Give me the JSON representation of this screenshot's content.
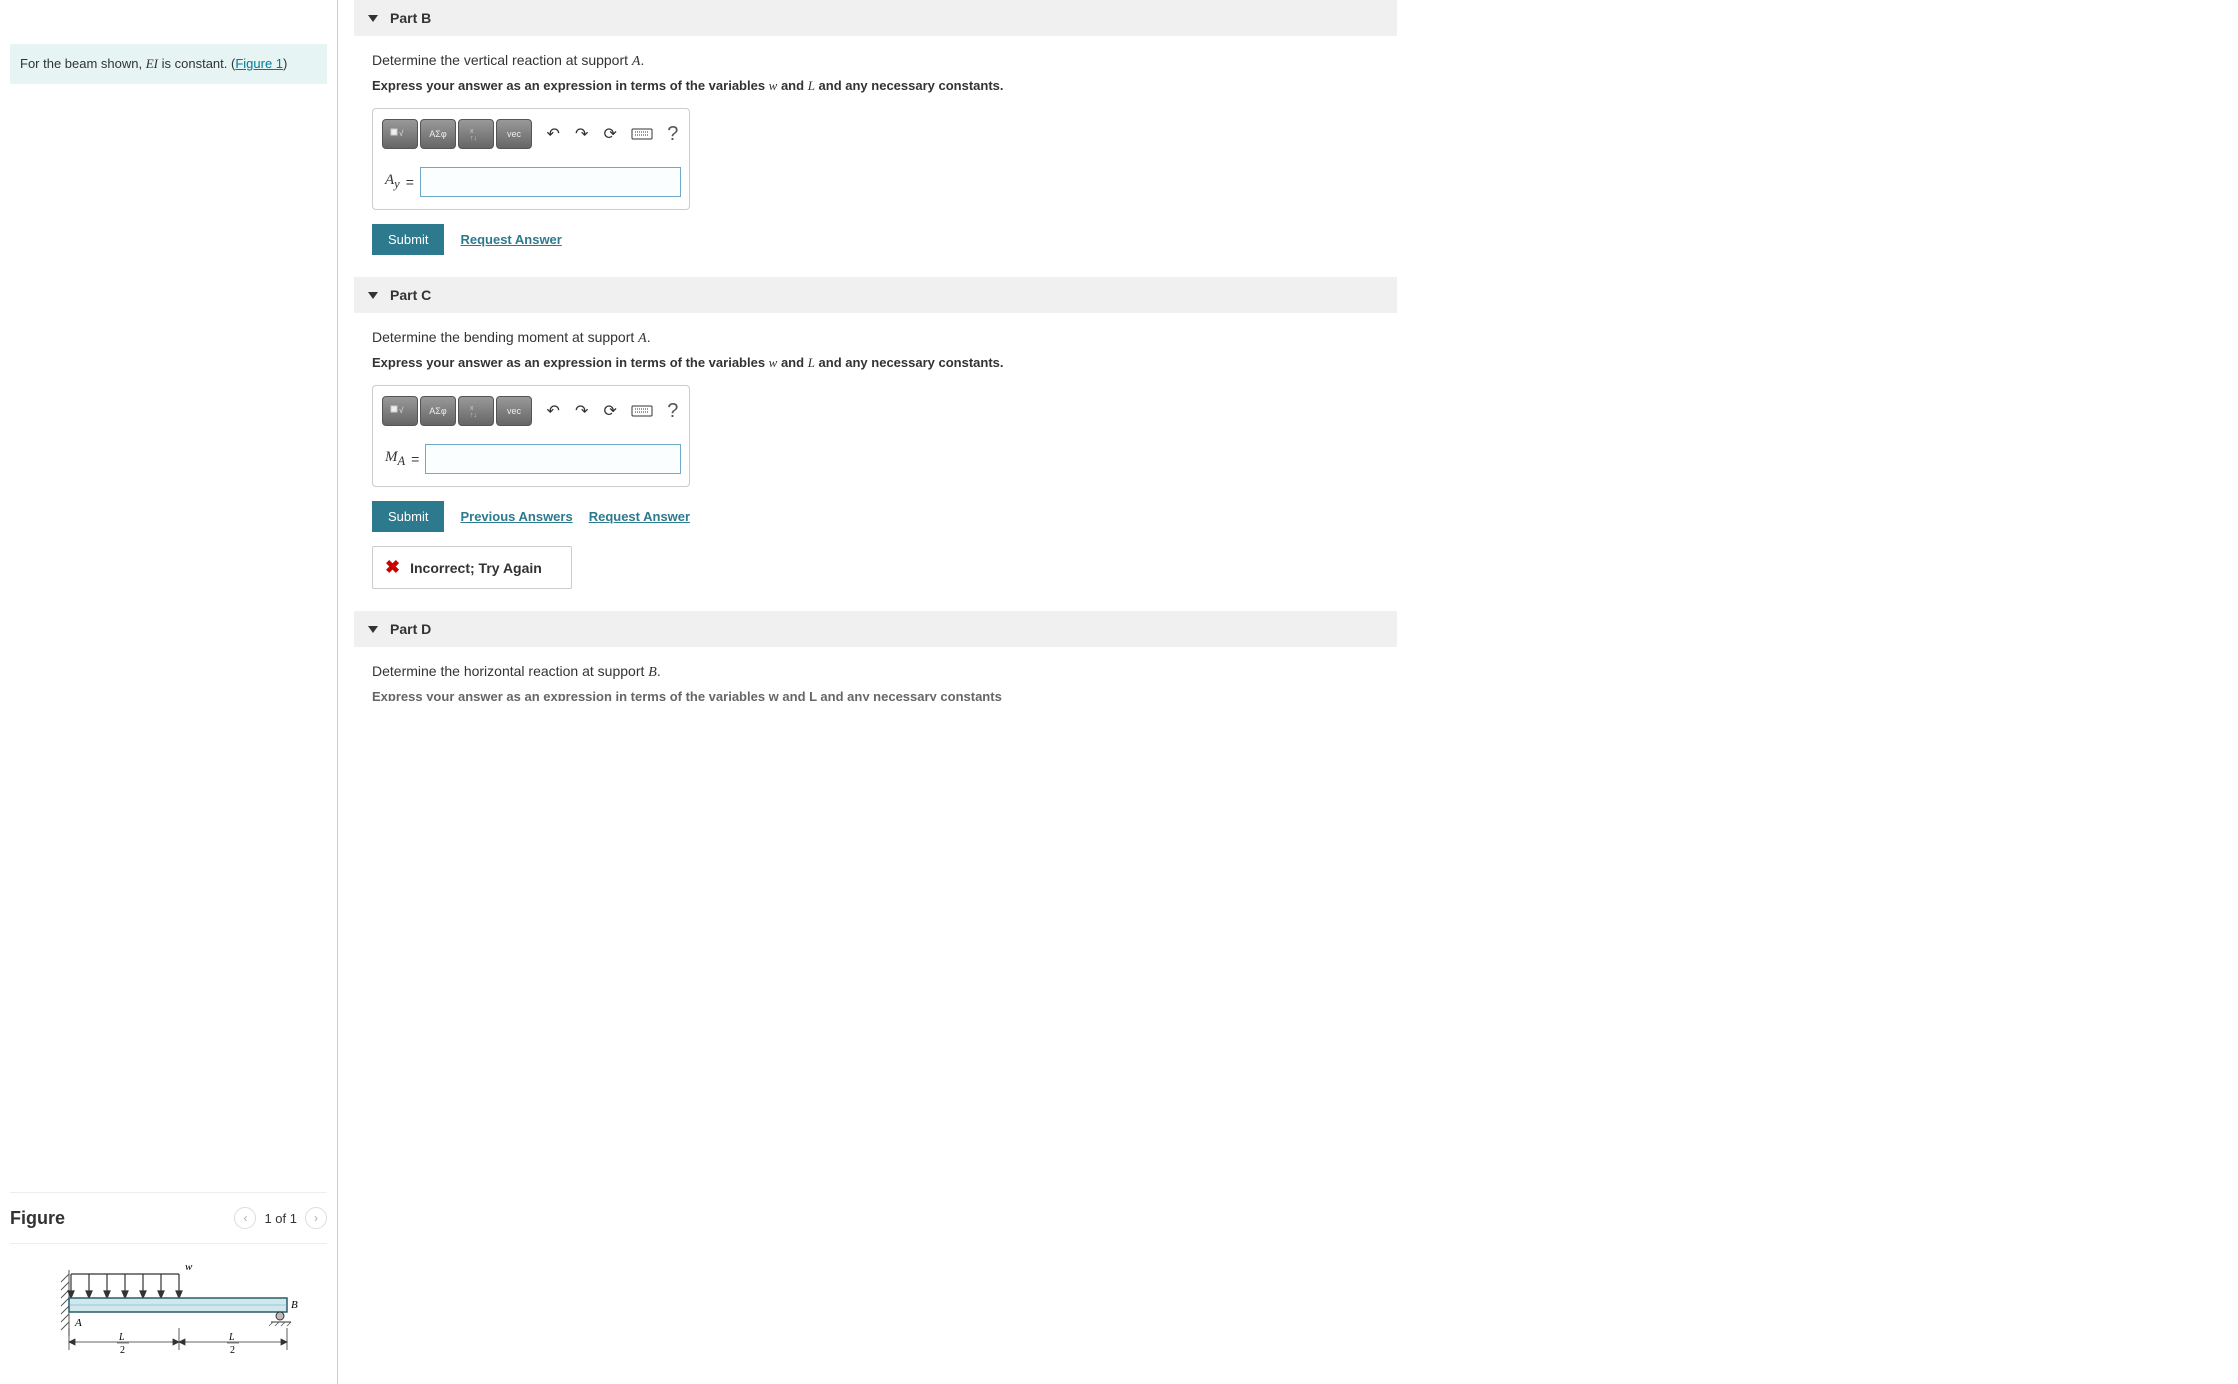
{
  "problem": {
    "text_before": "For the beam shown, ",
    "ei": "EI",
    "text_mid": " is constant. (",
    "figure_link": "Figure 1",
    "text_after": ")"
  },
  "figure": {
    "title": "Figure",
    "count": "1 of 1",
    "label_w": "w",
    "label_A": "A",
    "label_B": "B",
    "dim_left": "L",
    "dim_left_denom": "2",
    "dim_right": "L",
    "dim_right_denom": "2"
  },
  "parts": {
    "B": {
      "title": "Part B",
      "question_pre": "Determine the vertical reaction at support ",
      "question_var": "A",
      "question_post": ".",
      "instruction_pre": "Express your answer as an expression in terms of the variables ",
      "instruction_w": "w",
      "instruction_and": " and ",
      "instruction_L": "L",
      "instruction_post": " and any necessary constants.",
      "var_label": "A",
      "var_sub": "y",
      "answer_value": "",
      "submit": "Submit",
      "request": "Request Answer"
    },
    "C": {
      "title": "Part C",
      "question_pre": "Determine the bending moment at support ",
      "question_var": "A",
      "question_post": ".",
      "instruction_pre": "Express your answer as an expression in terms of the variables ",
      "instruction_w": "w",
      "instruction_and": " and ",
      "instruction_L": "L",
      "instruction_post": " and any necessary constants.",
      "var_label": "M",
      "var_sub": "A",
      "answer_value": "",
      "submit": "Submit",
      "previous": "Previous Answers",
      "request": "Request Answer",
      "feedback": "Incorrect; Try Again"
    },
    "D": {
      "title": "Part D",
      "question_pre": "Determine the horizontal reaction at support ",
      "question_var": "B",
      "question_post": ".",
      "truncated": "Express your answer as an expression in terms of the variables w and L and any necessary constants"
    }
  },
  "toolbar": {
    "greek": "ΑΣφ",
    "vec": "vec"
  }
}
